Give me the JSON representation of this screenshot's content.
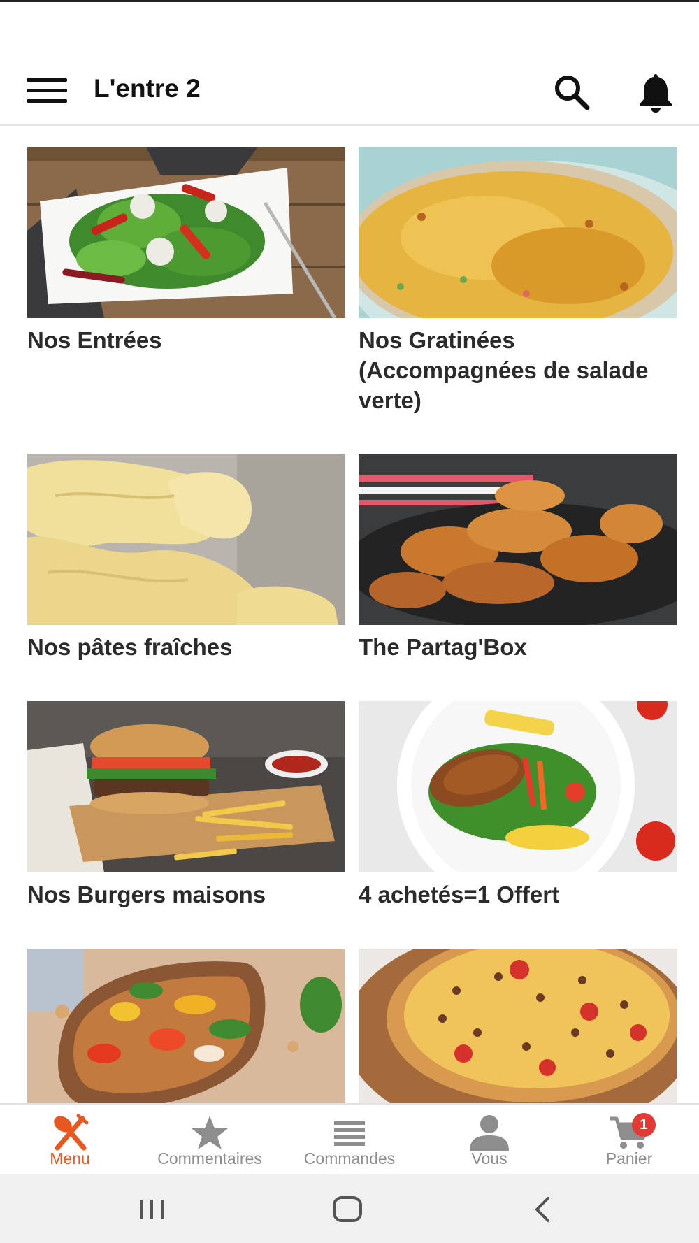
{
  "app_bar": {
    "title": "L'entre 2",
    "menu_icon": "hamburger-icon",
    "search_icon": "search-icon",
    "bell_icon": "bell-icon"
  },
  "categories": [
    {
      "label": "Nos Entrées",
      "image": "salad-image"
    },
    {
      "label": "Nos Gratinées (Accompagnées de salade verte)",
      "image": "gratin-image"
    },
    {
      "label": "Nos pâtes fraîches",
      "image": "pasta-image"
    },
    {
      "label": "The Partag'Box",
      "image": "fried-chicken-image"
    },
    {
      "label": "Nos Burgers maisons",
      "image": "burger-image"
    },
    {
      "label": "4 achetés=1 Offert",
      "image": "grilled-plate-image"
    },
    {
      "label": "",
      "image": "bruschetta-image"
    },
    {
      "label": "",
      "image": "pizza-image"
    }
  ],
  "bottom_nav": {
    "items": [
      {
        "label": "Menu",
        "icon": "fork-spoon-icon",
        "active": true
      },
      {
        "label": "Commentaires",
        "icon": "star-icon",
        "active": false
      },
      {
        "label": "Commandes",
        "icon": "list-icon",
        "active": false
      },
      {
        "label": "Vous",
        "icon": "person-icon",
        "active": false
      },
      {
        "label": "Panier",
        "icon": "cart-icon",
        "active": false
      }
    ],
    "cart_badge": "1"
  },
  "system_nav": {
    "icons": [
      "recent-apps-icon",
      "home-icon",
      "back-icon"
    ]
  },
  "colors": {
    "accent": "#e8581e",
    "inactive": "#8d8d8d",
    "badge": "#e53935"
  }
}
